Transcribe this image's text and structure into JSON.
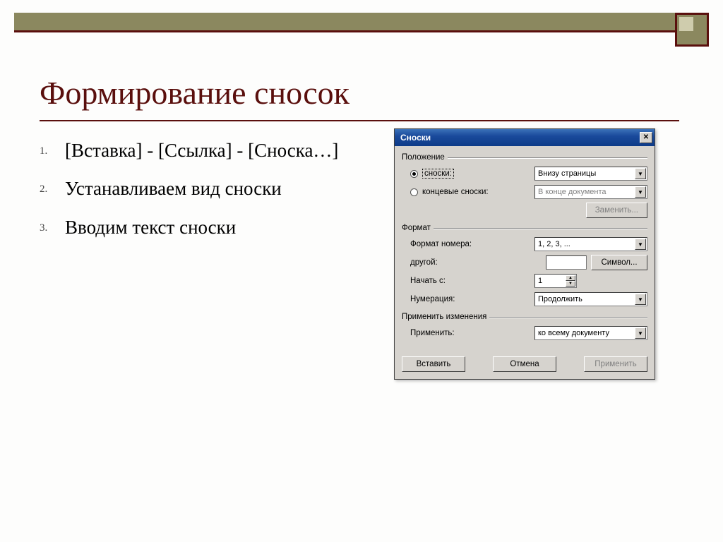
{
  "slide": {
    "title": "Формирование сносок",
    "items": [
      "[Вставка] - [Ссылка] - [Сноска…]",
      "Устанавливаем вид сноски",
      "Вводим текст сноски"
    ],
    "nums": [
      "1.",
      "2.",
      "3."
    ]
  },
  "dialog": {
    "title": "Сноски",
    "group_position": "Положение",
    "radio_footnote": "сноски:",
    "footnote_value": "Внизу страницы",
    "radio_endnote": "концевые сноски:",
    "endnote_value": "В конце документа",
    "btn_replace": "Заменить...",
    "group_format": "Формат",
    "lbl_numformat": "Формат номера:",
    "numformat_value": "1, 2, 3, ...",
    "lbl_other": "другой:",
    "btn_symbol": "Символ...",
    "lbl_start": "Начать с:",
    "start_value": "1",
    "lbl_numbering": "Нумерация:",
    "numbering_value": "Продолжить",
    "group_apply": "Применить изменения",
    "lbl_apply": "Применить:",
    "apply_value": "ко всему документу",
    "btn_insert": "Вставить",
    "btn_cancel": "Отмена",
    "btn_apply": "Применить"
  }
}
